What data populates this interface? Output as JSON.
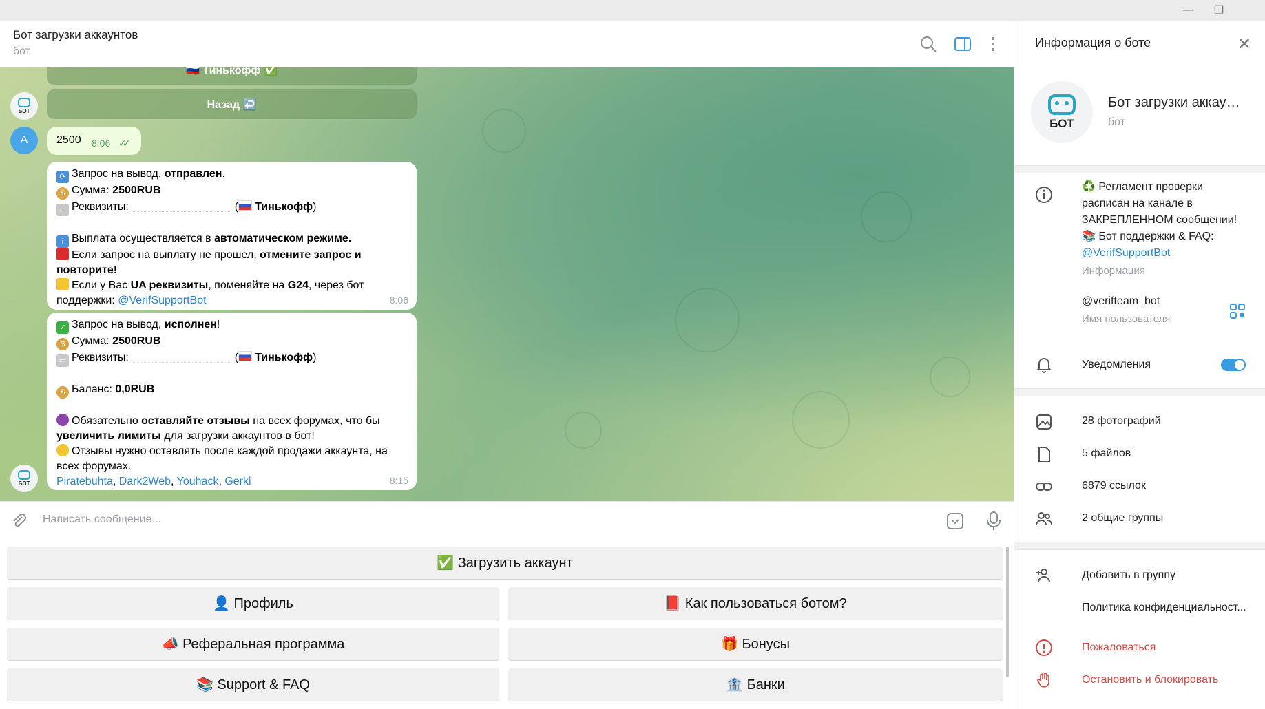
{
  "window": {
    "minimize_icon": "minimize-icon",
    "restore_icon": "restore-icon"
  },
  "header": {
    "title": "Бот загрузки аккаунтов",
    "subtitle": "бот"
  },
  "chat": {
    "inline_buttons": [
      {
        "label": "🇷🇺 Тинькофф ✅"
      },
      {
        "label": "Назад ↩️"
      }
    ],
    "user_avatar_letter": "A",
    "bot_avatar_label": "БОТ",
    "outgoing": {
      "text": "2500",
      "time": "8:06"
    },
    "msg1": {
      "time": "8:06",
      "l1a": "Запрос на вывод, ",
      "l1b": "отправлен",
      "l2a": "Сумма: ",
      "l2b": "2500RUB",
      "l3a": "Реквизиты: ",
      "l3b": " (",
      "l3c": "Тинькофф",
      "l3d": ")",
      "l4a": "Выплата осуществляется в ",
      "l4b": "автоматическом режиме.",
      "l5a": "Если запрос на выплату не прошел, ",
      "l5b": "отмените запрос и повторите!",
      "l6a": "Если у Вас ",
      "l6b": "UA реквизиты",
      "l6c": ", поменяйте на ",
      "l6d": "G24",
      "l6e": ", через бот поддержки: ",
      "l6link": "@VerifSupportBot"
    },
    "msg2": {
      "time": "8:15",
      "l1a": "Запрос на вывод, ",
      "l1b": "исполнен",
      "l1c": "!",
      "l2a": "Сумма: ",
      "l2b": "2500RUB",
      "l3a": "Реквизиты: ",
      "l3b": " (",
      "l3c": "Тинькофф",
      "l3d": ")",
      "l4a": "Баланс: ",
      "l4b": "0,0RUB",
      "l5a": "Обязательно ",
      "l5b": "оставляйте отзывы",
      "l5c": " на всех форумах, что бы ",
      "l5d": "увеличить лимиты",
      "l5e": " для загрузки аккаунтов в бот!",
      "l6": "Отзывы нужно оставлять после каждой продажи аккаунта, на всех форумах.",
      "links": [
        "Piratebuhta",
        "Dark2Web",
        "Youhack",
        "Gerki"
      ]
    }
  },
  "composer": {
    "placeholder": "Написать сообщение..."
  },
  "keyboard": {
    "upload": "✅ Загрузить аккаунт",
    "profile": "👤 Профиль",
    "howto": "📕 Как пользоваться ботом?",
    "referral": "📣 Реферальная программа",
    "bonuses": "🎁 Бонусы",
    "support": "📚 Support & FAQ",
    "banks": "🏦 Банки"
  },
  "panel": {
    "title": "Информация о боте",
    "name": "Бот загрузки аккаунтов",
    "role": "бот",
    "avatar_label": "БОТ",
    "info_l1": "♻️ Регламент проверки",
    "info_l2": "расписан на канале в",
    "info_l3": "ЗАКРЕПЛЕННОМ сообщении!",
    "info_l4": "📚 Бот поддержки & FAQ:",
    "info_link": "@VerifSupportBot",
    "info_caption": "Информация",
    "username": "@verifteam_bot",
    "username_caption": "Имя пользователя",
    "notifications": "Уведомления",
    "notifications_on": true,
    "photos": "28 фотографий",
    "files": "5 файлов",
    "links": "6879 ссылок",
    "groups": "2 общие группы",
    "add_to_group": "Добавить в группу",
    "privacy": "Политика конфиденциальност...",
    "report": "Пожаловаться",
    "block": "Остановить и блокировать"
  },
  "colors": {
    "accent": "#3a9be0",
    "danger": "#d84a44",
    "outgoing_bubble": "#effdde",
    "link": "#2a86c9"
  }
}
